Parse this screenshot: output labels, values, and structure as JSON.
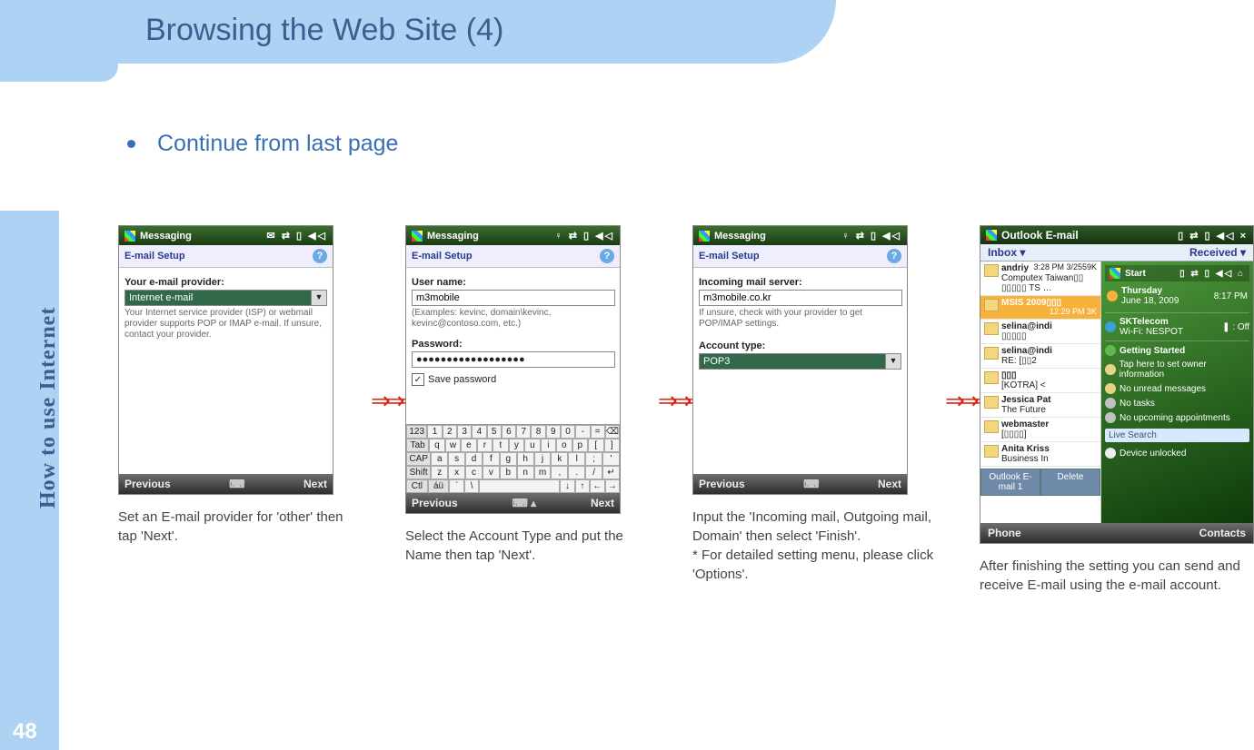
{
  "page": {
    "title": "Browsing the Web Site (4)",
    "bullet": "Continue from last page",
    "side_label": "How to use Internet",
    "number": "48"
  },
  "arrows": "⇒⇒⇒",
  "shot1": {
    "titlebar": "Messaging",
    "status_icons": "✉ ⇄ ▯ ◀◁",
    "subtitle": "E-mail Setup",
    "label": "Your e-mail provider:",
    "value": "Internet e-mail",
    "hint": "Your Internet service provider (ISP) or webmail provider supports POP or IMAP e-mail. If unsure, contact your provider.",
    "prev": "Previous",
    "next": "Next",
    "caption": "Set an E-mail provider for 'other' then tap 'Next'."
  },
  "shot2": {
    "titlebar": "Messaging",
    "status_icons": "♀ ⇄ ▯ ◀◁",
    "subtitle": "E-mail Setup",
    "user_label": "User name:",
    "user_value": "m3mobile",
    "user_hint": "(Examples: kevinc, domain\\kevinc, kevinc@contoso.com, etc.)",
    "pass_label": "Password:",
    "pass_value": "●●●●●●●●●●●●●●●●●●",
    "save_label": "Save password",
    "prev": "Previous",
    "next": "Next",
    "caption": "Select the Account Type and  put the Name then tap 'Next'.",
    "kb": {
      "r1": [
        "123",
        "1",
        "2",
        "3",
        "4",
        "5",
        "6",
        "7",
        "8",
        "9",
        "0",
        "-",
        "=",
        "⌫"
      ],
      "r2": [
        "Tab",
        "q",
        "w",
        "e",
        "r",
        "t",
        "y",
        "u",
        "i",
        "o",
        "p",
        "[",
        "]"
      ],
      "r3": [
        "CAP",
        "a",
        "s",
        "d",
        "f",
        "g",
        "h",
        "j",
        "k",
        "l",
        ";",
        "'"
      ],
      "r4": [
        "Shift",
        "z",
        "x",
        "c",
        "v",
        "b",
        "n",
        "m",
        ",",
        ".",
        "/",
        "↵"
      ],
      "r5": [
        "Ctl",
        "áü",
        "`",
        "\\",
        " ",
        "↓",
        "↑",
        "←",
        "→"
      ]
    }
  },
  "shot3": {
    "titlebar": "Messaging",
    "status_icons": "♀ ⇄ ▯ ◀◁",
    "subtitle": "E-mail Setup",
    "server_label": "Incoming mail server:",
    "server_value": "m3mobile.co.kr",
    "server_hint": "If unsure, check with your provider to get POP/IMAP settings.",
    "acct_label": "Account type:",
    "acct_value": "POP3",
    "prev": "Previous",
    "next": "Next",
    "caption": "Input the 'Incoming mail, Outgoing mail, Domain' then select 'Finish'.\n* For detailed setting menu, please click 'Options'."
  },
  "shot4": {
    "titlebar": "Outlook E-mail",
    "status_icons": "▯ ⇄ ▯ ◀◁ ×",
    "head_left": "Inbox ▾",
    "head_right": "Received ▾",
    "messages": [
      {
        "from": "andriy",
        "meta": "3:28 PM  3/2559K",
        "sub": "Computex Taiwan▯▯ ▯▯▯▯▯ TS …"
      },
      {
        "from": "MSIS 2009▯▯▯",
        "meta": "12:29 PM    3K",
        "sub": "",
        "sel": true
      },
      {
        "from": "selina@indi",
        "meta": "",
        "sub": "▯▯▯▯▯"
      },
      {
        "from": "selina@indi",
        "meta": "",
        "sub": "RE: [▯▯2"
      },
      {
        "from": "▯▯▯",
        "meta": "",
        "sub": "[KOTRA] <"
      },
      {
        "from": "Jessica Pat",
        "meta": "",
        "sub": "The Future"
      },
      {
        "from": "webmaster",
        "meta": "",
        "sub": "[▯▯▯▯]"
      },
      {
        "from": "Anita Kriss",
        "meta": "",
        "sub": "Business In"
      }
    ],
    "left_btn1": "Outlook E-mail 1",
    "left_btn2": "Delete",
    "today": {
      "start": "Start",
      "start_icons": "▯ ⇄ ▯ ◀◁ ⌂",
      "date_line1": "Thursday",
      "date_line2": "June 18, 2009",
      "time": "8:17 PM",
      "carrier": "SKTelecom",
      "wifi": "Wi-Fi: NESPOT",
      "wifi_state": "❚ : Off",
      "gs": "Getting Started",
      "owner": "Tap here to set owner information",
      "unread": "No unread messages",
      "tasks": "No tasks",
      "appt": "No upcoming appointments",
      "search": "Live Search",
      "lock": "Device unlocked"
    },
    "foot_left": "Phone",
    "foot_right": "Contacts",
    "caption": "After finishing the setting you can send and receive E-mail using the e-mail account."
  }
}
